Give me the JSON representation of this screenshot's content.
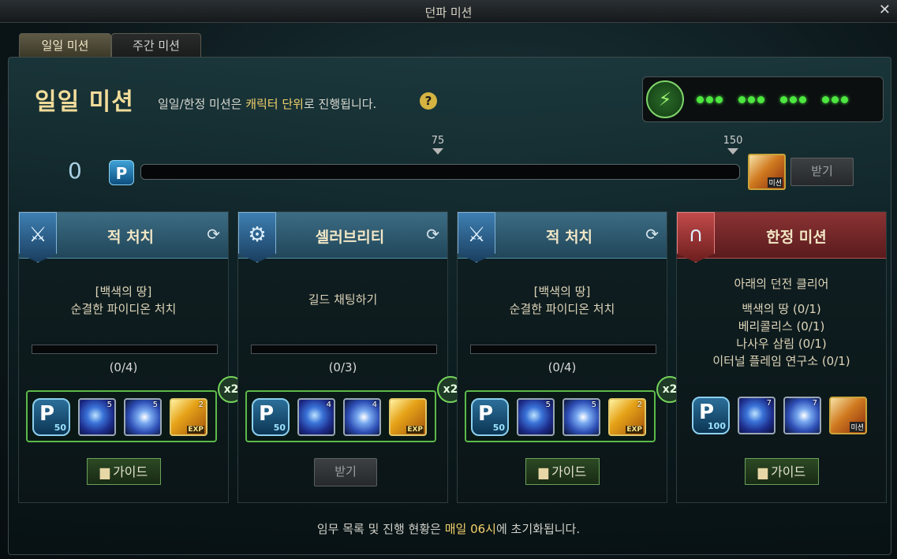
{
  "window": {
    "title": "던파 미션",
    "close_glyph": "✕"
  },
  "tabs": [
    {
      "label": "일일 미션",
      "active": true
    },
    {
      "label": "주간 미션",
      "active": false
    }
  ],
  "header": {
    "title": "일일 미션",
    "subtext_before": "일일/한정 미션은 ",
    "subtext_highlight": "캐릭터 단위",
    "subtext_after": "로 진행됩니다.",
    "help_glyph": "?"
  },
  "energy": {
    "icon": "battery-icon",
    "icon_glyph": "⚡",
    "dot_groups": 4,
    "dots_per_group": 3,
    "color": "#4ee640"
  },
  "progress": {
    "points": "0",
    "point_icon_label": "P",
    "current_fraction": 0,
    "milestones": [
      {
        "value": "75"
      },
      {
        "value": "150"
      }
    ],
    "reward_label": "미션",
    "claim_label": "받기"
  },
  "cards": [
    {
      "title": "적 처치",
      "icon": "sword-shield-icon",
      "icon_glyph": "⚔",
      "theme": "blue",
      "desc_lines": [
        "[백색의 땅]",
        "순결한 파이디온 처치"
      ],
      "count": "(0/4)",
      "rewards": [
        {
          "kind": "pt",
          "label": "P",
          "num": "50"
        },
        {
          "kind": "orb",
          "qty": "5"
        },
        {
          "kind": "orb2",
          "qty": "5"
        },
        {
          "kind": "exp",
          "qty": "2",
          "label": "EXP"
        }
      ],
      "multiplier": "x2",
      "button": "가이드",
      "button_type": "guide"
    },
    {
      "title": "셀러브리티",
      "icon": "gear-icon",
      "icon_glyph": "⚙",
      "theme": "blue",
      "desc_lines": [
        "길드 채팅하기"
      ],
      "count": "(0/3)",
      "rewards": [
        {
          "kind": "pt",
          "label": "P",
          "num": "50"
        },
        {
          "kind": "orb",
          "qty": "4"
        },
        {
          "kind": "orb2",
          "qty": "4"
        },
        {
          "kind": "exp",
          "qty": "",
          "label": "EXP"
        }
      ],
      "multiplier": "x2",
      "button": "받기",
      "button_type": "claim"
    },
    {
      "title": "적 처치",
      "icon": "sword-shield-icon",
      "icon_glyph": "⚔",
      "theme": "blue",
      "desc_lines": [
        "[백색의 땅]",
        "순결한 파이디온 처치"
      ],
      "count": "(0/4)",
      "rewards": [
        {
          "kind": "pt",
          "label": "P",
          "num": "50"
        },
        {
          "kind": "orb",
          "qty": "5"
        },
        {
          "kind": "orb2",
          "qty": "5"
        },
        {
          "kind": "exp",
          "qty": "2",
          "label": "EXP"
        }
      ],
      "multiplier": "x2",
      "button": "가이드",
      "button_type": "guide"
    },
    {
      "title": "한정 미션",
      "icon": "gate-icon",
      "icon_glyph": "∩",
      "theme": "red",
      "desc_lines": [
        "아래의 던전 클리어"
      ],
      "dungeons": [
        "백색의 땅 (0/1)",
        "베리콜리스 (0/1)",
        "나사우 삼림 (0/1)",
        "이터널 플레임 연구소 (0/1)"
      ],
      "rewards": [
        {
          "kind": "pt",
          "label": "P",
          "num": "100"
        },
        {
          "kind": "orb",
          "qty": "7"
        },
        {
          "kind": "orb2",
          "qty": "7"
        },
        {
          "kind": "mission",
          "label": "미션"
        }
      ],
      "button": "가이드",
      "button_type": "guide"
    }
  ],
  "footer": {
    "before": "임무 목록 및 진행 현황은 ",
    "highlight": "매일 06시",
    "after": "에 초기화됩니다."
  }
}
